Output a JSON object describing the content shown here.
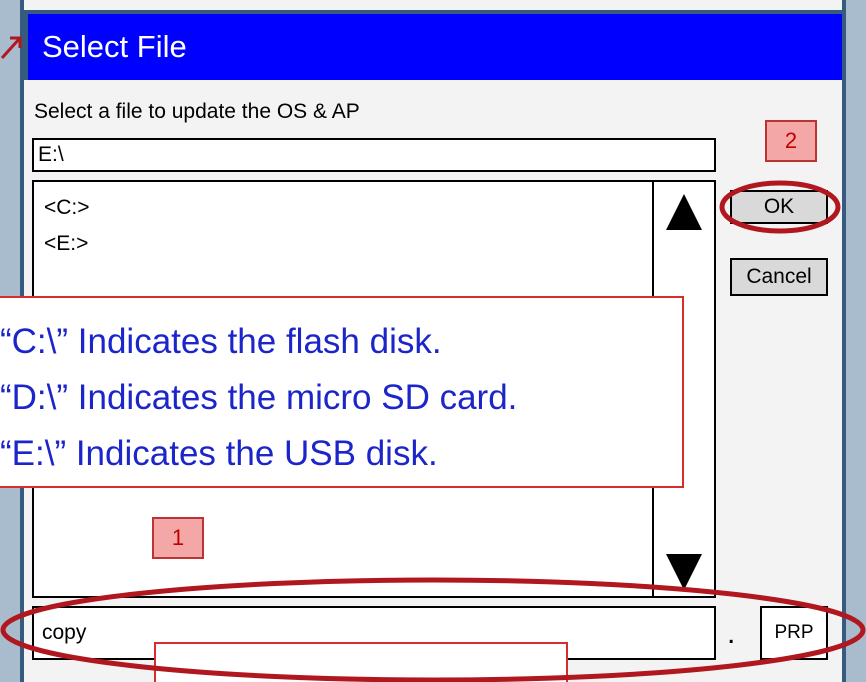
{
  "dialog": {
    "title": "Select File",
    "prompt": "Select a file to update the OS & AP",
    "path": "E:\\",
    "files": [
      "<C:>",
      "<E:>"
    ],
    "ok_label": "OK",
    "cancel_label": "Cancel",
    "filename": "copy",
    "separator": ".",
    "extension": "PRP"
  },
  "annotations": {
    "callout_lines": [
      "“C:\\” Indicates the flash disk.",
      "“D:\\” Indicates the micro SD card.",
      "“E:\\” Indicates the USB disk."
    ],
    "badge_1": "1",
    "badge_2": "2"
  },
  "colors": {
    "titlebar": "#0000ff",
    "highlight_ring": "#b0171f",
    "callout_text": "#1b25c9",
    "background": "#a9bccd"
  },
  "icons": [
    "scroll-up-icon",
    "scroll-down-icon",
    "pointer-arrow-icon"
  ]
}
